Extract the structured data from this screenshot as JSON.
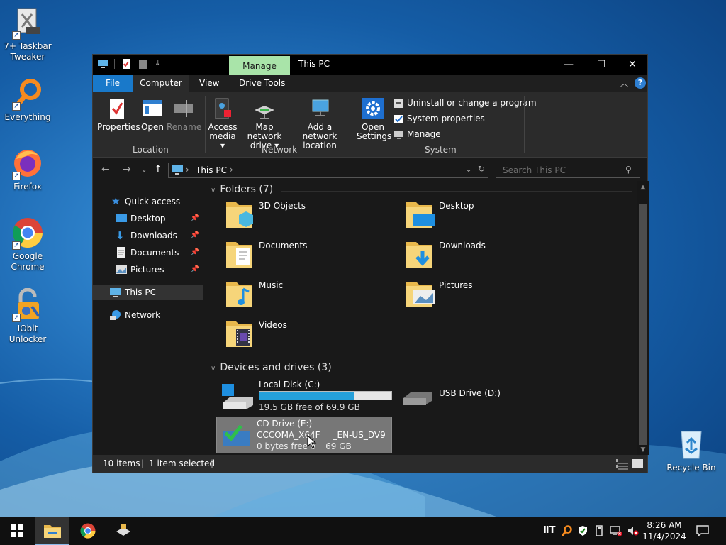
{
  "desktop": {
    "icons": [
      {
        "label": "7+ Taskbar Tweaker"
      },
      {
        "label": "Everything"
      },
      {
        "label": "Firefox"
      },
      {
        "label": "Google Chrome"
      },
      {
        "label": "IObit Unlocker"
      },
      {
        "label": "Recycle Bin"
      }
    ]
  },
  "window": {
    "title": "This PC",
    "context_tab": "Manage",
    "tabs": [
      "File",
      "Computer",
      "View",
      "Drive Tools"
    ],
    "ribbon": {
      "location": {
        "label": "Location",
        "buttons": [
          "Properties",
          "Open",
          "Rename"
        ]
      },
      "network": {
        "label": "Network",
        "access_media": "Access media",
        "map_drive": "Map network drive",
        "add_location": "Add a network location"
      },
      "system": {
        "label": "System",
        "open_settings": "Open Settings",
        "uninstall": "Uninstall or change a program",
        "properties": "System properties",
        "manage": "Manage"
      }
    },
    "address": {
      "path": "This PC",
      "search_placeholder": "Search This PC"
    },
    "sidebar": {
      "quick_access": "Quick access",
      "pinned": [
        "Desktop",
        "Downloads",
        "Documents",
        "Pictures"
      ],
      "this_pc": "This PC",
      "network": "Network"
    },
    "folders": {
      "heading": "Folders (7)",
      "items": [
        "3D Objects",
        "Desktop",
        "Documents",
        "Downloads",
        "Music",
        "Pictures",
        "Videos"
      ]
    },
    "drives": {
      "heading": "Devices and drives (3)",
      "local_disk": {
        "name": "Local Disk (C:)",
        "free_text": "19.5 GB free of 69.9 GB",
        "used_fraction": 0.72
      },
      "usb": {
        "name": "USB Drive (D:)"
      },
      "cd": {
        "name": "CD Drive (E:)",
        "volume": "CCCOMA_X64F",
        "volume_end": "_EN-US_DV9",
        "free_text": "0 bytes free o",
        "free_end": "69 GB"
      }
    },
    "status": {
      "items": "10 items",
      "selected": "1 item selected"
    }
  },
  "taskbar": {
    "time": "8:26 AM",
    "date": "11/4/2024"
  },
  "colors": {
    "file_tab": "#1979ca",
    "manage_tab": "#a9e4a9",
    "drive_bar": "#26a0da"
  }
}
